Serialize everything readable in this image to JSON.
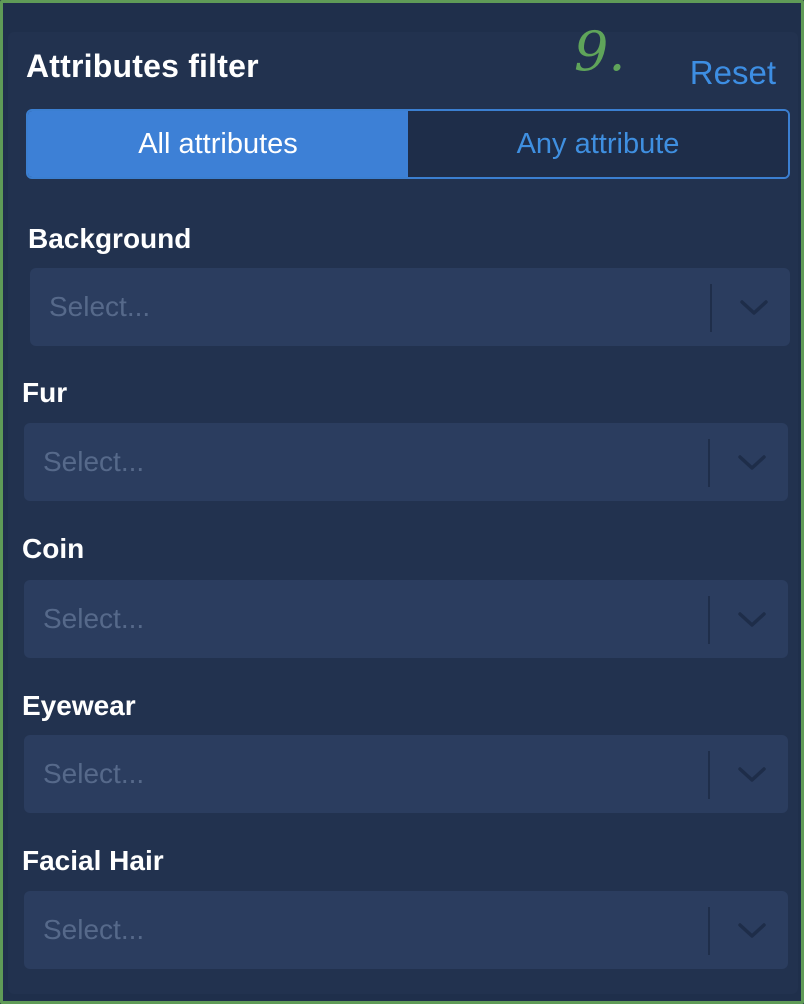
{
  "panel": {
    "title": "Attributes filter",
    "reset_label": "Reset",
    "annotation": "9."
  },
  "mode_toggle": {
    "options": [
      {
        "label": "All attributes",
        "active": true
      },
      {
        "label": "Any attribute",
        "active": false
      }
    ]
  },
  "filters": [
    {
      "label": "Background",
      "placeholder": "Select..."
    },
    {
      "label": "Fur",
      "placeholder": "Select..."
    },
    {
      "label": "Coin",
      "placeholder": "Select..."
    },
    {
      "label": "Eyewear",
      "placeholder": "Select..."
    },
    {
      "label": "Facial Hair",
      "placeholder": "Select..."
    }
  ],
  "colors": {
    "accent": "#3d80d6",
    "link": "#3d8ee3",
    "panel_bg": "#22324f",
    "select_bg": "#2b3d5f",
    "annotation_frame": "#5f9b57"
  },
  "icons": {
    "dropdown": "chevron-down-icon"
  }
}
